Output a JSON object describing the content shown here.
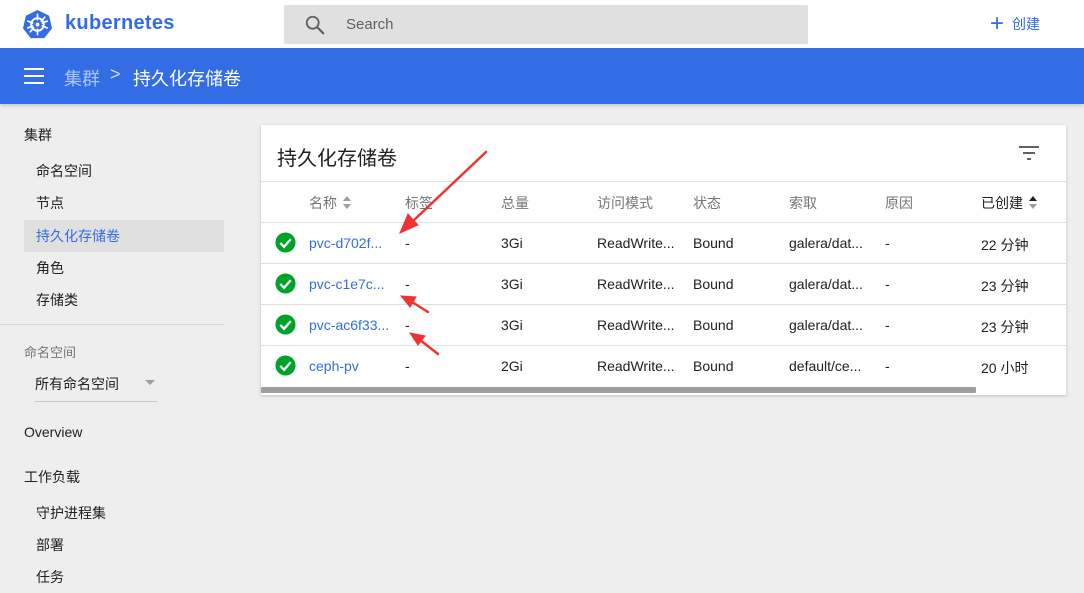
{
  "header": {
    "brand": "kubernetes",
    "search_placeholder": "Search",
    "create_label": "创建"
  },
  "breadcrumb": {
    "parent": "集群",
    "separator": ">",
    "current": "持久化存储卷"
  },
  "sidebar": {
    "cluster_heading": "集群",
    "cluster_items": [
      {
        "label": "命名空间"
      },
      {
        "label": "节点"
      },
      {
        "label": "持久化存储卷"
      },
      {
        "label": "角色"
      },
      {
        "label": "存储类"
      }
    ],
    "namespace_label": "命名空间",
    "namespace_selected": "所有命名空间",
    "overview": "Overview",
    "workloads_heading": "工作负载",
    "workload_items": [
      {
        "label": "守护进程集"
      },
      {
        "label": "部署"
      },
      {
        "label": "任务"
      }
    ]
  },
  "card": {
    "title": "持久化存储卷",
    "columns": {
      "name": "名称",
      "labels": "标签",
      "capacity": "总量",
      "access_modes": "访问模式",
      "status": "状态",
      "claim": "索取",
      "reason": "原因",
      "created": "已创建"
    },
    "rows": [
      {
        "name": "pvc-d702f...",
        "labels": "-",
        "capacity": "3Gi",
        "access": "ReadWrite...",
        "status": "Bound",
        "claim": "galera/dat...",
        "reason": "-",
        "created": "22 分钟"
      },
      {
        "name": "pvc-c1e7c...",
        "labels": "-",
        "capacity": "3Gi",
        "access": "ReadWrite...",
        "status": "Bound",
        "claim": "galera/dat...",
        "reason": "-",
        "created": "23 分钟"
      },
      {
        "name": "pvc-ac6f33...",
        "labels": "-",
        "capacity": "3Gi",
        "access": "ReadWrite...",
        "status": "Bound",
        "claim": "galera/dat...",
        "reason": "-",
        "created": "23 分钟"
      },
      {
        "name": "ceph-pv",
        "labels": "-",
        "capacity": "2Gi",
        "access": "ReadWrite...",
        "status": "Bound",
        "claim": "default/ce...",
        "reason": "-",
        "created": "20 小时"
      }
    ]
  },
  "colors": {
    "brand_blue": "#326de6",
    "status_green": "#00a32a",
    "annotation_red": "#ee3333"
  },
  "icons": [
    "kubernetes-logo-icon",
    "search-icon",
    "plus-icon",
    "menu-icon",
    "filter-icon",
    "check-circle-icon",
    "sort-icon",
    "chevron-down-icon"
  ]
}
